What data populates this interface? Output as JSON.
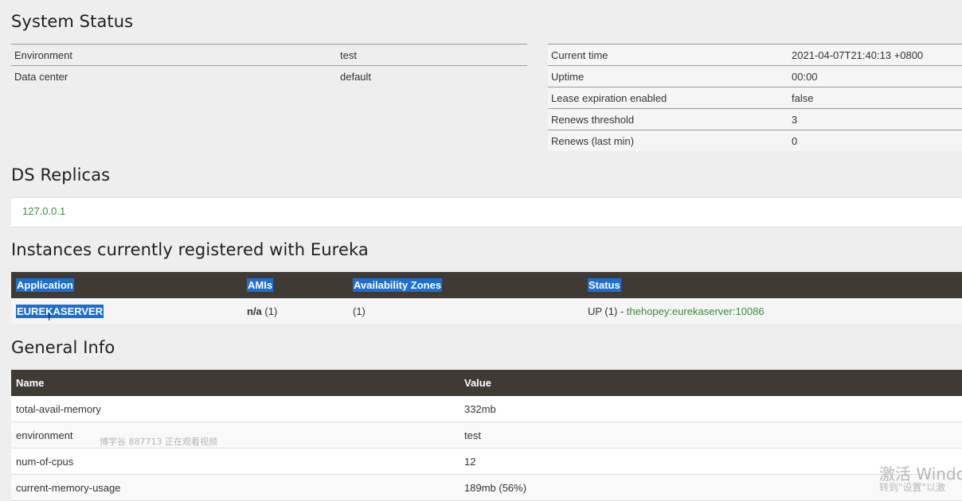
{
  "system_status": {
    "title": "System Status",
    "left": [
      {
        "key": "Environment",
        "value": "test"
      },
      {
        "key": "Data center",
        "value": "default"
      }
    ],
    "right": [
      {
        "key": "Current time",
        "value": "2021-04-07T21:40:13 +0800"
      },
      {
        "key": "Uptime",
        "value": "00:00"
      },
      {
        "key": "Lease expiration enabled",
        "value": "false"
      },
      {
        "key": "Renews threshold",
        "value": "3"
      },
      {
        "key": "Renews (last min)",
        "value": "0"
      }
    ]
  },
  "replicas": {
    "title": "DS Replicas",
    "items": [
      "127.0.0.1"
    ]
  },
  "instances": {
    "title": "Instances currently registered with Eureka",
    "headers": [
      "Application",
      "AMIs",
      "Availability Zones",
      "Status"
    ],
    "rows": [
      {
        "application": "EUREKASERVER",
        "amis_bold": "n/a",
        "amis_count": " (1)",
        "zones": "(1)",
        "status_text": "UP (1) - ",
        "status_link": "thehopey:eurekaserver:10086"
      }
    ]
  },
  "general_info": {
    "title": "General Info",
    "headers": [
      "Name",
      "Value"
    ],
    "rows": [
      {
        "name": "total-avail-memory",
        "value": "332mb"
      },
      {
        "name": "environment",
        "value": "test"
      },
      {
        "name": "num-of-cpus",
        "value": "12"
      },
      {
        "name": "current-memory-usage",
        "value": "189mb (56%)"
      }
    ]
  },
  "overlay": {
    "viewer_watermark": "博学谷 887713 正在观看视频",
    "activation_line1": "激活 Windo",
    "activation_line2": "转到\"设置\"以激"
  },
  "colors": {
    "header_bg": "#403a35",
    "link_green": "#3d8b3d",
    "selection_blue": "#1b6ed3",
    "page_bg": "#eeeeee"
  }
}
